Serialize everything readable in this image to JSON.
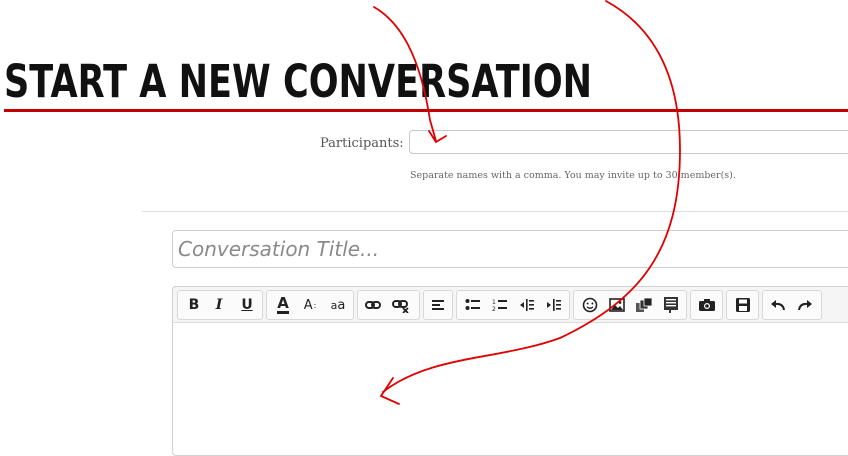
{
  "page": {
    "title": "START A NEW CONVERSATION"
  },
  "participants": {
    "label": "Participants:",
    "value": "",
    "hint": "Separate names with a comma. You may invite up to 30 member(s)."
  },
  "conversation": {
    "title_placeholder": "Conversation Title..."
  },
  "toolbar": {
    "bold": "B",
    "italic": "I",
    "underline": "U",
    "font_color": "A",
    "font_size": "A",
    "font_family": "a",
    "icons": [
      "bold-icon",
      "italic-icon",
      "underline-icon",
      "font-color-icon",
      "font-size-icon",
      "font-family-icon",
      "link-icon",
      "unlink-icon",
      "align-icon",
      "bullet-list-icon",
      "numbered-list-icon",
      "outdent-icon",
      "indent-icon",
      "smilie-icon",
      "image-icon",
      "media-icon",
      "code-icon",
      "camera-icon",
      "save-draft-icon",
      "undo-icon",
      "redo-icon"
    ]
  },
  "colors": {
    "accent": "#c20000",
    "annotation": "#e00000"
  }
}
